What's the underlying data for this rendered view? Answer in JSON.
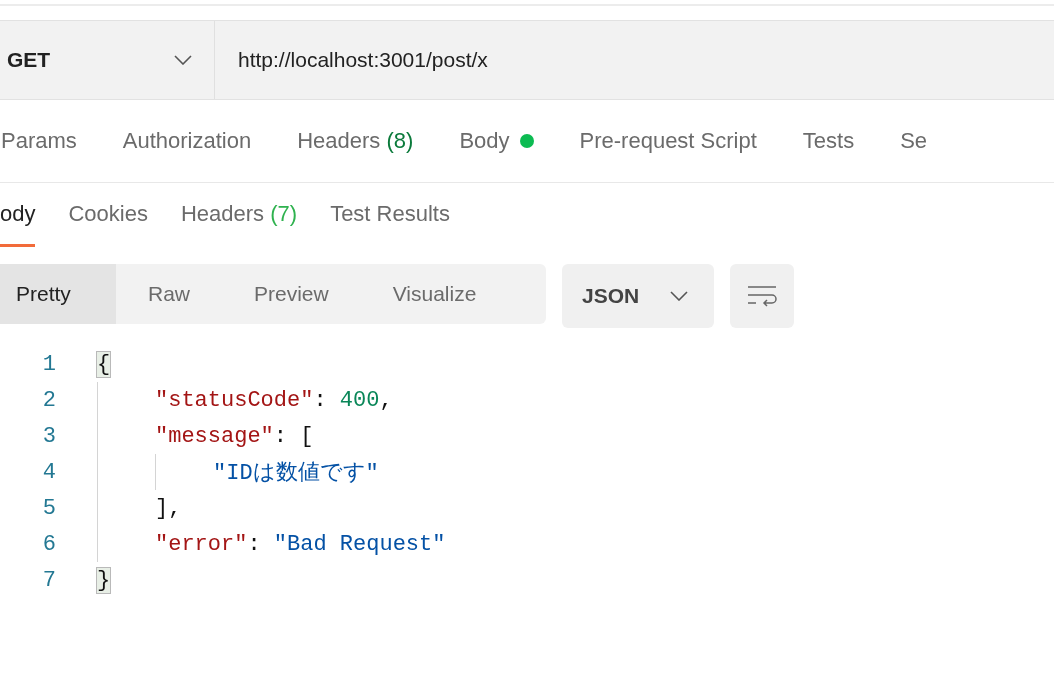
{
  "request": {
    "method": "GET",
    "url": "http://localhost:3001/post/x"
  },
  "request_tabs": [
    {
      "label": "Params",
      "selected": false
    },
    {
      "label": "Authorization",
      "selected": false
    },
    {
      "label": "Headers",
      "count": "(8)",
      "selected": false
    },
    {
      "label": "Body",
      "has_content": true,
      "selected": false
    },
    {
      "label": "Pre-request Script",
      "selected": false
    },
    {
      "label": "Tests",
      "selected": false
    },
    {
      "label": "Se",
      "selected": false
    }
  ],
  "response_tabs": [
    {
      "label": "ody",
      "selected": true
    },
    {
      "label": "Cookies",
      "selected": false
    },
    {
      "label": "Headers",
      "count": "(7)",
      "selected": false
    },
    {
      "label": "Test Results",
      "selected": false
    }
  ],
  "view_modes": [
    {
      "label": "Pretty",
      "selected": true
    },
    {
      "label": "Raw",
      "selected": false
    },
    {
      "label": "Preview",
      "selected": false
    },
    {
      "label": "Visualize",
      "selected": false
    }
  ],
  "format": "JSON",
  "code": [
    {
      "number": "1",
      "tokens": [
        {
          "kind": "punct",
          "text": "{",
          "bracket_match": true
        }
      ],
      "children": [
        {
          "number": "2",
          "tokens": [
            {
              "kind": "key",
              "text": "\"statusCode\"",
              "bracket_match": false
            },
            {
              "kind": "punct",
              "text": ": ",
              "bracket_match": false
            },
            {
              "kind": "number",
              "text": "400",
              "bracket_match": false
            },
            {
              "kind": "punct",
              "text": ",",
              "bracket_match": false
            }
          ]
        },
        {
          "number": "3",
          "tokens": [
            {
              "kind": "key",
              "text": "\"message\"",
              "bracket_match": false
            },
            {
              "kind": "punct",
              "text": ": [",
              "bracket_match": false
            }
          ],
          "children": [
            {
              "number": "4",
              "tokens": [
                {
                  "kind": "string",
                  "text": "\"IDは数値です\"",
                  "bracket_match": false
                }
              ]
            }
          ]
        },
        {
          "number": "5",
          "tokens": [
            {
              "kind": "punct",
              "text": "],",
              "bracket_match": false
            }
          ]
        },
        {
          "number": "6",
          "tokens": [
            {
              "kind": "key",
              "text": "\"error\"",
              "bracket_match": false
            },
            {
              "kind": "punct",
              "text": ": ",
              "bracket_match": false
            },
            {
              "kind": "string",
              "text": "\"Bad Request\"",
              "bracket_match": false
            }
          ]
        }
      ]
    },
    {
      "number": "7",
      "tokens": [
        {
          "kind": "punct",
          "text": "}",
          "bracket_match": true
        }
      ]
    }
  ]
}
